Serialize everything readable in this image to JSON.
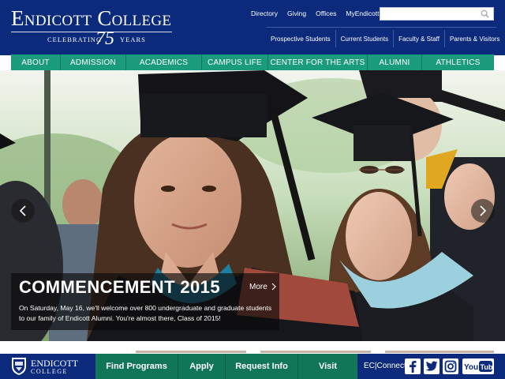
{
  "header": {
    "logo_title": "Endicott College",
    "logo_tagline_left": "CELEBRATING",
    "logo_number": "75",
    "logo_tagline_right": "YEARS",
    "utility_links": [
      "Directory",
      "Giving",
      "Offices",
      "MyEndicott"
    ],
    "search_placeholder": "",
    "audience_links": [
      "Prospective Students",
      "Current Students",
      "Faculty & Staff",
      "Parents & Visitors"
    ]
  },
  "nav": {
    "items": [
      "ABOUT",
      "ADMISSION",
      "ACADEMICS",
      "CAMPUS LIFE",
      "CENTER FOR THE ARTS",
      "ALUMNI",
      "ATHLETICS"
    ]
  },
  "hero": {
    "title": "COMMENCEMENT 2015",
    "more_label": "More",
    "body": "On Saturday, May 16, we'll welcome over 800 undergraduate and graduate students to our family of Endicott Alumni. You're almost there, Class of 2015!"
  },
  "footer": {
    "logo_main": "ENDICOTT",
    "logo_sub": "COLLEGE",
    "links": [
      "Find Programs",
      "Apply",
      "Request Info",
      "Visit"
    ],
    "connect_label": "EC|Connect",
    "youtube_label": "YouTube"
  },
  "colors": {
    "navy": "#0b2a7c",
    "nav_green": "#1a9b7c",
    "footer_green": "#117658"
  },
  "icons": [
    "search-icon",
    "chevron-left-icon",
    "chevron-right-icon",
    "chevron-right-small-icon",
    "facebook-icon",
    "twitter-icon",
    "instagram-icon",
    "youtube-icon",
    "crest-icon"
  ]
}
